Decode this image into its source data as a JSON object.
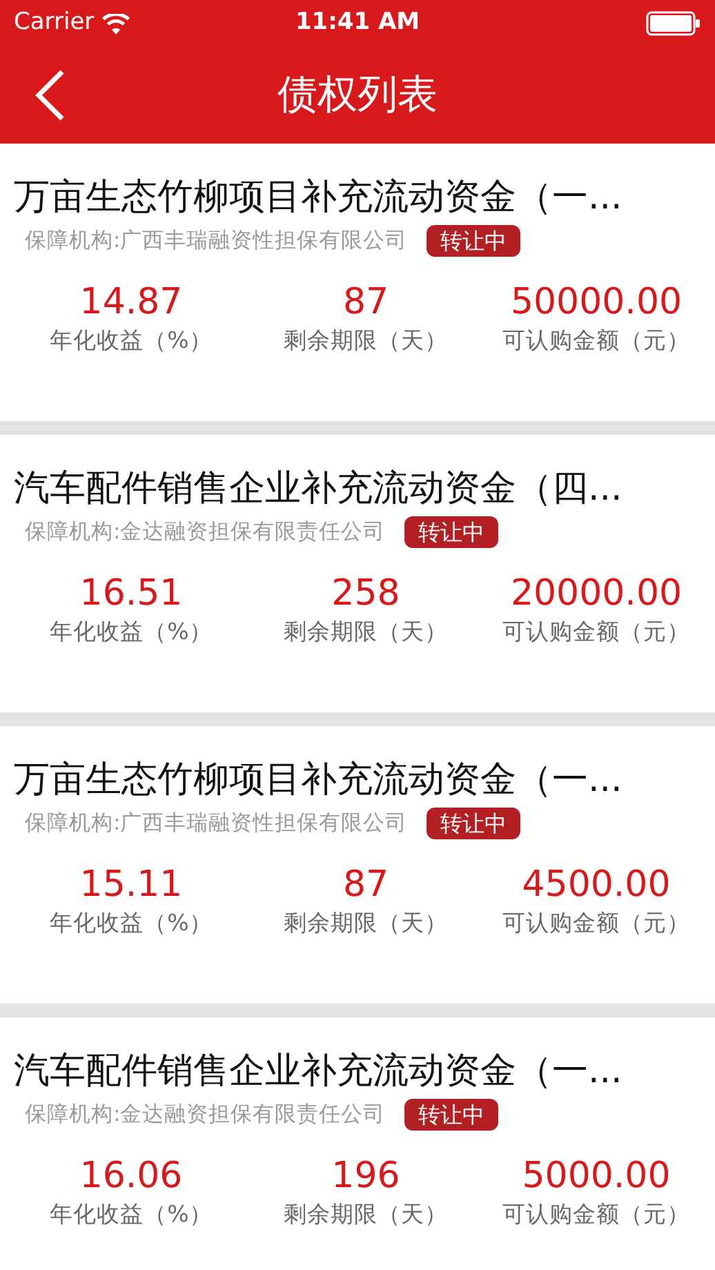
{
  "status_bar": {
    "carrier": "Carrier",
    "time": "11:41 AM"
  },
  "nav": {
    "title": "债权列表"
  },
  "items": [
    {
      "title": "万亩生态竹柳项目补充流动资金（一...",
      "guarantor": "保障机构:广西丰瑞融资性担保有限公司",
      "badge": "转让中",
      "stats": [
        {
          "value": "14.87",
          "label": "年化收益（%）"
        },
        {
          "value": "87",
          "label": "剩余期限（天）"
        },
        {
          "value": "50000.00",
          "label": "可认购金额（元）"
        }
      ]
    },
    {
      "title": "汽车配件销售企业补充流动资金（四...",
      "guarantor": "保障机构:金达融资担保有限责任公司",
      "badge": "转让中",
      "stats": [
        {
          "value": "16.51",
          "label": "年化收益（%）"
        },
        {
          "value": "258",
          "label": "剩余期限（天）"
        },
        {
          "value": "20000.00",
          "label": "可认购金额（元）"
        }
      ]
    },
    {
      "title": "万亩生态竹柳项目补充流动资金（一...",
      "guarantor": "保障机构:广西丰瑞融资性担保有限公司",
      "badge": "转让中",
      "stats": [
        {
          "value": "15.11",
          "label": "年化收益（%）"
        },
        {
          "value": "87",
          "label": "剩余期限（天）"
        },
        {
          "value": "4500.00",
          "label": "可认购金额（元）"
        }
      ]
    },
    {
      "title": "汽车配件销售企业补充流动资金（一...",
      "guarantor": "保障机构:金达融资担保有限责任公司",
      "badge": "转让中",
      "stats": [
        {
          "value": "16.06",
          "label": "年化收益（%）"
        },
        {
          "value": "196",
          "label": "剩余期限（天）"
        },
        {
          "value": "5000.00",
          "label": "可认购金额（元）"
        }
      ]
    }
  ]
}
